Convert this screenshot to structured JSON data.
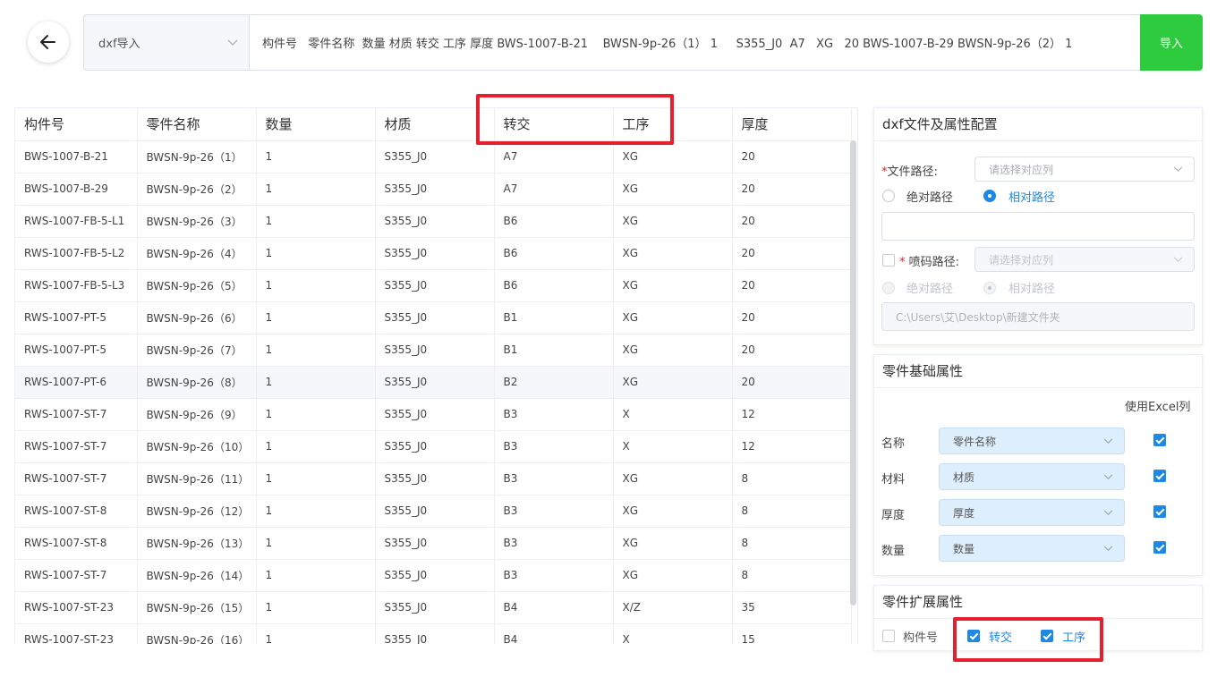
{
  "header": {
    "mode_select": "dxf导入",
    "paste_text": "构件号   零件名称  数量 材质 转交 工序 厚度 BWS-1007-B-21    BWSN-9p-26（1） 1     S355_J0  A7   XG   20 BWS-1007-B-29 BWSN-9p-26（2） 1",
    "import_label": "导入"
  },
  "table": {
    "columns": [
      "构件号",
      "零件名称",
      "数量",
      "材质",
      "转交",
      "工序",
      "厚度"
    ],
    "rows": [
      [
        "BWS-1007-B-21",
        "BWSN-9p-26（1）",
        "1",
        "S355_J0",
        "A7",
        "XG",
        "20"
      ],
      [
        "BWS-1007-B-29",
        "BWSN-9p-26（2）",
        "1",
        "S355_J0",
        "A7",
        "XG",
        "20"
      ],
      [
        "RWS-1007-FB-5-L1",
        "BWSN-9p-26（3）",
        "1",
        "S355_J0",
        "B6",
        "XG",
        "20"
      ],
      [
        "RWS-1007-FB-5-L2",
        "BWSN-9p-26（4）",
        "1",
        "S355_J0",
        "B6",
        "XG",
        "20"
      ],
      [
        "RWS-1007-FB-5-L3",
        "BWSN-9p-26（5）",
        "1",
        "S355_J0",
        "B6",
        "XG",
        "20"
      ],
      [
        "RWS-1007-PT-5",
        "BWSN-9p-26（6）",
        "1",
        "S355_J0",
        "B1",
        "XG",
        "20"
      ],
      [
        "RWS-1007-PT-5",
        "BWSN-9p-26（7）",
        "1",
        "S355_J0",
        "B1",
        "XG",
        "20"
      ],
      [
        "RWS-1007-PT-6",
        "BWSN-9p-26（8）",
        "1",
        "S355_J0",
        "B2",
        "XG",
        "20"
      ],
      [
        "RWS-1007-ST-7",
        "BWSN-9p-26（9）",
        "1",
        "S355_J0",
        "B3",
        "X",
        "12"
      ],
      [
        "RWS-1007-ST-7",
        "BWSN-9p-26（10）",
        "1",
        "S355_J0",
        "B3",
        "X",
        "12"
      ],
      [
        "RWS-1007-ST-7",
        "BWSN-9p-26（11）",
        "1",
        "S355_J0",
        "B3",
        "XG",
        "8"
      ],
      [
        "RWS-1007-ST-8",
        "BWSN-9p-26（12）",
        "1",
        "S355_J0",
        "B3",
        "XG",
        "8"
      ],
      [
        "RWS-1007-ST-8",
        "BWSN-9p-26（13）",
        "1",
        "S355_J0",
        "B3",
        "XG",
        "8"
      ],
      [
        "RWS-1007-ST-7",
        "BWSN-9p-26（14）",
        "1",
        "S355_J0",
        "B3",
        "XG",
        "8"
      ],
      [
        "RWS-1007-ST-23",
        "BWSN-9p-26（15）",
        "1",
        "S355_J0",
        "B4",
        "X/Z",
        "35"
      ],
      [
        "RWS-1007-ST-23",
        "BWSN-9p-26（16）",
        "1",
        "S355_J0",
        "B4",
        "X",
        "15"
      ]
    ]
  },
  "config": {
    "title": "dxf文件及属性配置",
    "file_path_label": "文件路径:",
    "file_path_placeholder": "请选择对应列",
    "absolute_label": "绝对路径",
    "relative_label": "相对路径",
    "spray_label": "喷码路径:",
    "spray_placeholder": "请选择对应列",
    "spray_absolute_label": "绝对路径",
    "spray_relative_label": "相对路径",
    "spray_path_value": "C:\\Users\\艾\\Desktop\\新建文件夹"
  },
  "basic": {
    "title": "零件基础属性",
    "use_excel_label": "使用Excel列",
    "rows": [
      {
        "label": "名称",
        "value": "零件名称"
      },
      {
        "label": "材料",
        "value": "材质"
      },
      {
        "label": "厚度",
        "value": "厚度"
      },
      {
        "label": "数量",
        "value": "数量"
      }
    ]
  },
  "extended": {
    "title": "零件扩展属性",
    "items": [
      "构件号",
      "转交",
      "工序"
    ]
  },
  "colors": {
    "accent": "#1e88e5",
    "import_green": "#2fcb3f",
    "highlight_red": "#e5202e"
  }
}
